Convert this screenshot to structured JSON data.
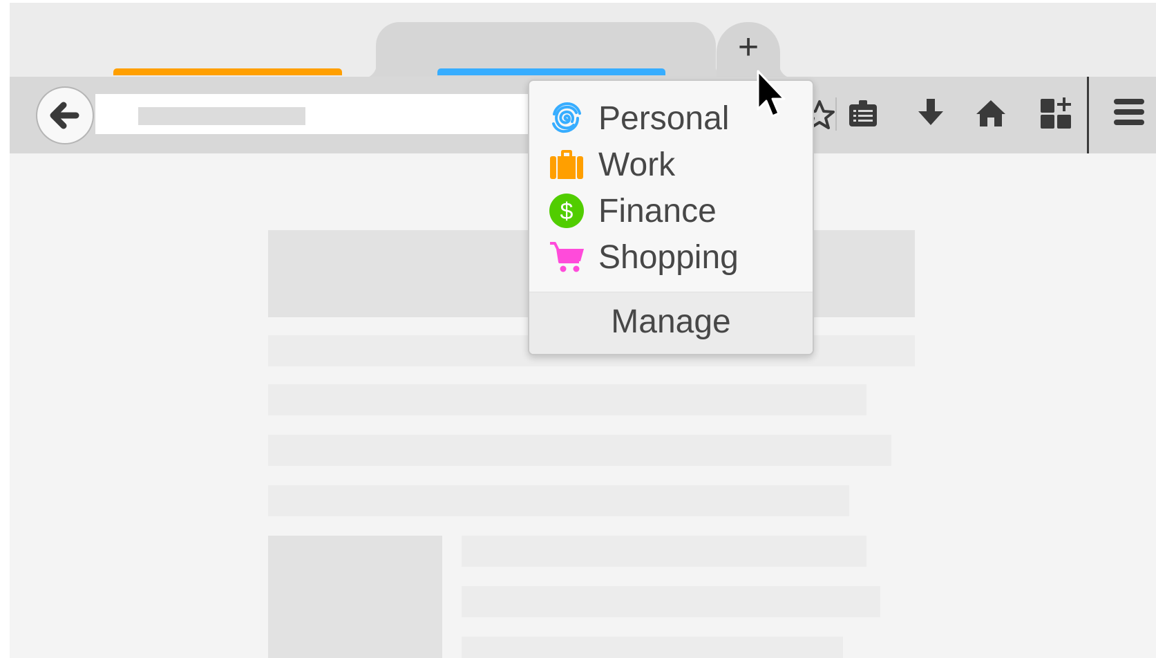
{
  "tabs": {
    "tab1_color": "#ff9f00",
    "tab2_color": "#37adff",
    "new_tab_symbol": "+"
  },
  "toolbar": {
    "back_icon": "arrow-left-icon",
    "icons": [
      "star-icon",
      "reading-list-icon",
      "download-icon",
      "home-icon",
      "add-widget-icon",
      "menu-icon"
    ]
  },
  "container_menu": {
    "items": [
      {
        "label": "Personal",
        "icon": "fingerprint-icon",
        "color": "#37adff"
      },
      {
        "label": "Work",
        "icon": "briefcase-icon",
        "color": "#ff9f00"
      },
      {
        "label": "Finance",
        "icon": "dollar-icon",
        "color": "#51cd00"
      },
      {
        "label": "Shopping",
        "icon": "cart-icon",
        "color": "#ff4bda"
      }
    ],
    "manage_label": "Manage"
  }
}
